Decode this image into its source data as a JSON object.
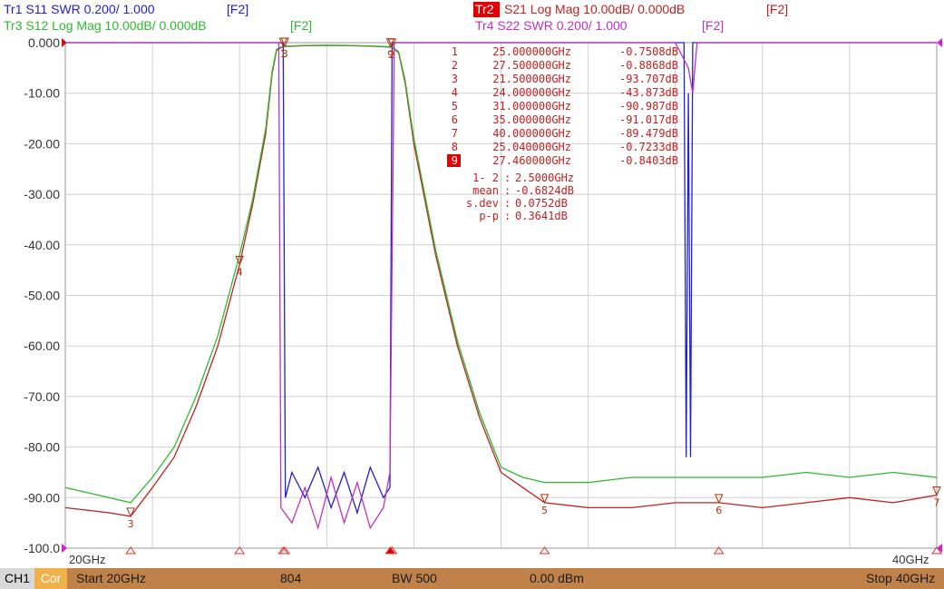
{
  "window": {
    "channel": "CH1",
    "correction": "Cor"
  },
  "traces": [
    {
      "label": "Tr1 S11 SWR 0.200/ 1.000",
      "soft_key": "[F2]",
      "color": "#2020d0"
    },
    {
      "label": "Tr2",
      "sublabel": "S21 Log Mag 10.00dB/ 0.000dB",
      "soft_key": "[F2]",
      "color": "#c02020",
      "active": true
    },
    {
      "label": "Tr3 S12 Log Mag 10.00dB/ 0.000dB",
      "soft_key": "[F2]",
      "color": "#2eb82e"
    },
    {
      "label": "Tr4 S22 SWR 0.200/ 1.000",
      "soft_key": "[F2]",
      "color": "#c030c0"
    }
  ],
  "marker_table": {
    "rows": [
      {
        "n": "1",
        "freq": "25.000000GHz",
        "val": "-0.7508dB"
      },
      {
        "n": "2",
        "freq": "27.500000GHz",
        "val": "-0.8868dB"
      },
      {
        "n": "3",
        "freq": "21.500000GHz",
        "val": "-93.707dB"
      },
      {
        "n": "4",
        "freq": "24.000000GHz",
        "val": "-43.873dB"
      },
      {
        "n": "5",
        "freq": "31.000000GHz",
        "val": "-90.987dB"
      },
      {
        "n": "6",
        "freq": "35.000000GHz",
        "val": "-91.017dB"
      },
      {
        "n": "7",
        "freq": "40.000000GHz",
        "val": "-89.479dB"
      },
      {
        "n": "8",
        "freq": "25.040000GHz",
        "val": "-0.7233dB"
      },
      {
        "n": "9",
        "freq": "27.460000GHz",
        "val": "-0.8403dB",
        "active": true
      }
    ],
    "stats": [
      {
        "label": "1- 2",
        "value": "2.5000GHz"
      },
      {
        "label": "mean",
        "value": "-0.6824dB"
      },
      {
        "label": "s.dev",
        "value": "0.0752dB"
      },
      {
        "label": "p-p",
        "value": "0.3641dB"
      }
    ]
  },
  "status_bar": {
    "start": "Start 20GHz",
    "points": "804",
    "bandwidth": "BW 500",
    "power": "0.00 dBm",
    "stop": "Stop 40GHz"
  },
  "chart_data": {
    "type": "line",
    "x_unit": "GHz",
    "xlim": [
      20,
      40
    ],
    "ylim": [
      -100,
      0
    ],
    "y_ticks": [
      "0.000",
      "-10.00",
      "-20.00",
      "-30.00",
      "-40.00",
      "-50.00",
      "-60.00",
      "-70.00",
      "-80.00",
      "-90.00",
      "-100.0"
    ],
    "x_start_label": "20GHz",
    "x_stop_label": "40GHz",
    "grid": true,
    "series": [
      {
        "name": "S21",
        "color": "#c02020",
        "x": [
          20.0,
          21.0,
          21.5,
          22.0,
          22.5,
          23.0,
          23.5,
          24.0,
          24.3,
          24.6,
          24.75,
          24.85,
          25.0,
          25.5,
          26.0,
          26.5,
          27.0,
          27.5,
          27.65,
          27.8,
          28.0,
          28.5,
          29.0,
          29.5,
          30.0,
          30.5,
          31.0,
          32.0,
          33.0,
          34.0,
          35.0,
          36.0,
          37.0,
          38.0,
          39.0,
          40.0
        ],
        "y": [
          -92,
          -93,
          -93.7,
          -88,
          -82,
          -72,
          -60,
          -43.9,
          -32,
          -18,
          -6,
          -1.5,
          -0.75,
          -0.6,
          -0.55,
          -0.6,
          -0.7,
          -0.89,
          -2,
          -8,
          -20,
          -42,
          -60,
          -74,
          -85,
          -88,
          -91,
          -92,
          -92,
          -91,
          -91,
          -92,
          -91,
          -90,
          -91,
          -89.5
        ]
      },
      {
        "name": "S12",
        "color": "#2eb82e",
        "x": [
          20.0,
          21.0,
          21.5,
          22.0,
          22.5,
          23.0,
          23.5,
          24.0,
          24.3,
          24.6,
          24.75,
          24.85,
          25.0,
          25.5,
          26.0,
          26.5,
          27.0,
          27.5,
          27.65,
          27.8,
          28.0,
          28.5,
          29.0,
          29.5,
          30.0,
          30.5,
          31.0,
          32.0,
          33.0,
          34.0,
          35.0,
          36.0,
          37.0,
          38.0,
          39.0,
          40.0
        ],
        "y": [
          -88,
          -90,
          -91,
          -86,
          -80,
          -70,
          -58,
          -42,
          -31,
          -17,
          -5.5,
          -1.3,
          -0.7,
          -0.55,
          -0.5,
          -0.55,
          -0.65,
          -0.85,
          -1.8,
          -7.5,
          -19,
          -41,
          -59,
          -73,
          -84,
          -86,
          -87,
          -87,
          -86,
          -86,
          -86,
          -86,
          -85,
          -86,
          -85,
          -86
        ]
      },
      {
        "name": "S11",
        "color": "#2020d0",
        "x": [
          20.0,
          25.0,
          25.05,
          25.2,
          25.5,
          25.8,
          26.1,
          26.4,
          26.7,
          27.0,
          27.3,
          27.45,
          27.5,
          30.0,
          32.0,
          33.0,
          34.0,
          34.2,
          34.25,
          34.3,
          34.35,
          34.4,
          34.5,
          36.0,
          40.0
        ],
        "y": [
          0,
          0,
          -90,
          -85,
          -90,
          -84,
          -92,
          -85,
          -93,
          -84,
          -90,
          -88,
          0,
          0,
          0,
          0,
          0,
          0,
          -82,
          -10,
          -82,
          0,
          0,
          0,
          0
        ]
      },
      {
        "name": "S22",
        "color": "#c030c0",
        "x": [
          20.0,
          24.9,
          24.95,
          25.2,
          25.5,
          25.8,
          26.1,
          26.4,
          26.7,
          27.0,
          27.3,
          27.45,
          27.55,
          30.0,
          34.0,
          34.3,
          34.4,
          34.5,
          36.0,
          40.0
        ],
        "y": [
          0,
          0,
          -92,
          -95,
          -88,
          -96,
          -86,
          -95,
          -87,
          -96,
          -92,
          -85,
          0,
          0,
          0,
          -5,
          -10,
          0,
          0,
          0
        ]
      }
    ],
    "markers": [
      {
        "n": "1",
        "x": 25.0,
        "y": -0.75
      },
      {
        "n": "2",
        "x": 27.5,
        "y": -0.89
      },
      {
        "n": "3",
        "x": 21.5,
        "y": -93.7
      },
      {
        "n": "4",
        "x": 24.0,
        "y": -43.9
      },
      {
        "n": "5",
        "x": 31.0,
        "y": -91.0
      },
      {
        "n": "6",
        "x": 35.0,
        "y": -91.0
      },
      {
        "n": "7",
        "x": 40.0,
        "y": -89.5
      },
      {
        "n": "8",
        "x": 25.04,
        "y": -0.72
      },
      {
        "n": "9",
        "x": 27.46,
        "y": -0.84
      }
    ]
  }
}
